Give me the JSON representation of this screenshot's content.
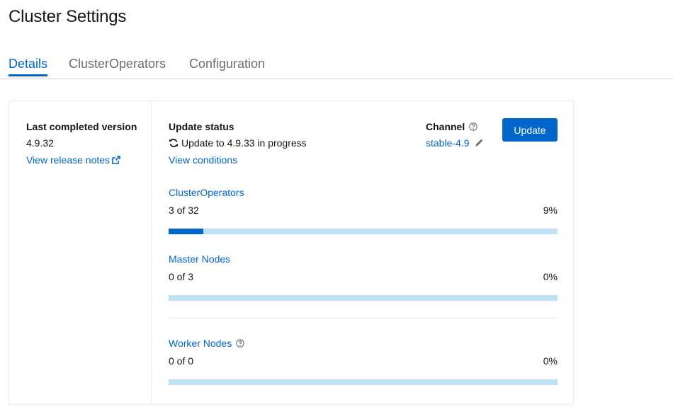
{
  "page": {
    "title": "Cluster Settings"
  },
  "tabs": [
    {
      "label": "Details",
      "active": true
    },
    {
      "label": "ClusterOperators",
      "active": false
    },
    {
      "label": "Configuration",
      "active": false
    }
  ],
  "version": {
    "label": "Last completed version",
    "value": "4.9.32",
    "release_notes_link": "View release notes",
    "release_notes_icon": "external-link-icon"
  },
  "update_status": {
    "label": "Update status",
    "icon": "sync-icon",
    "text": "Update to 4.9.33 in progress",
    "conditions_link": "View conditions"
  },
  "channel": {
    "label": "Channel",
    "help_icon": "help-icon",
    "value": "stable-4.9",
    "edit_icon": "pencil-icon"
  },
  "update_button": {
    "label": "Update"
  },
  "progress": {
    "cluster_operators": {
      "label": "ClusterOperators",
      "count": "3 of 32",
      "percent_text": "9%",
      "fraction": 0.09
    },
    "master_nodes": {
      "label": "Master Nodes",
      "count": "0 of 3",
      "percent_text": "0%",
      "fraction": 0.0
    },
    "worker_nodes": {
      "label": "Worker Nodes",
      "count": "0 of 0",
      "percent_text": "0%",
      "fraction": 0.0,
      "help_icon": "help-icon"
    }
  },
  "colors": {
    "link": "#0066cc",
    "progress_fill": "#0066cc",
    "progress_track": "#bee1f4",
    "button_bg": "#0066cc"
  }
}
